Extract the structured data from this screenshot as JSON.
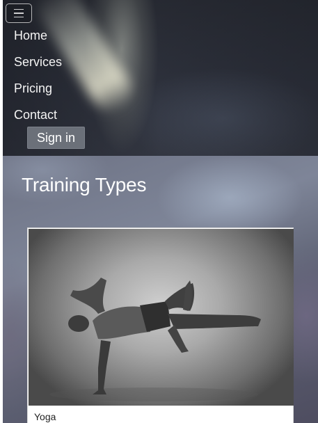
{
  "nav": {
    "toggle_icon": "hamburger-menu-icon",
    "links": [
      "Home",
      "Services",
      "Pricing",
      "Contact"
    ],
    "signin_label": "Sign in"
  },
  "main": {
    "heading": "Training Types",
    "cards": [
      {
        "title": "Yoga"
      }
    ]
  },
  "colors": {
    "nav_bg": "#2b2e37",
    "signin_bg": "#6b7079",
    "text_light": "#ffffff",
    "card_bg": "#ffffff"
  }
}
